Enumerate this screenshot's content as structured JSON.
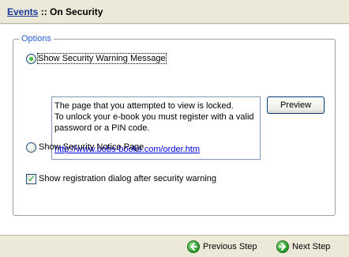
{
  "header": {
    "link": "Events",
    "separator": " :: ",
    "title": "On Security"
  },
  "options": {
    "legend": "Options",
    "radio_warning_label": "Show Security Warning Message",
    "radio_notice_label": "Show Security Notice Page",
    "checkbox_label": "Show registration dialog after security warning",
    "selected": "warning",
    "checkbox_checked": true
  },
  "message": {
    "line1": "The page that you attempted to view is locked.",
    "line2": "To unlock your e-book you must register with a valid",
    "line3": "password or a PIN code.",
    "link": "http://www.bobs-books.com/order.htm"
  },
  "buttons": {
    "preview": "Preview",
    "previous_step": "Previous Step",
    "next_step": "Next Step"
  }
}
